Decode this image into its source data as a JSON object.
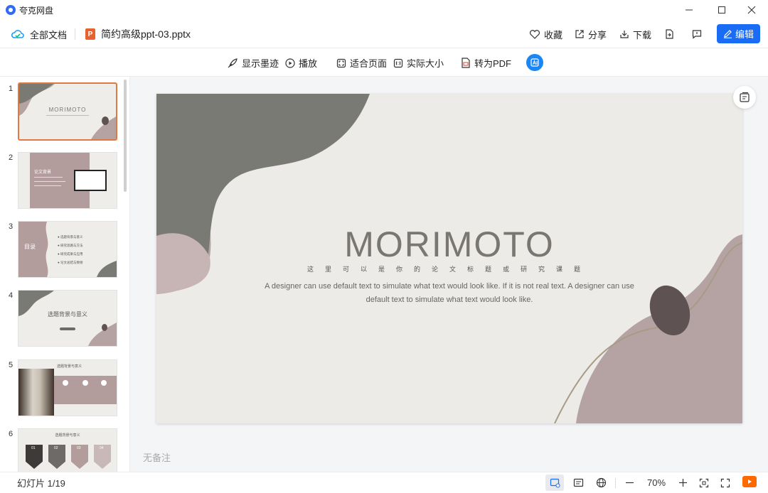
{
  "app": {
    "title": "夸克网盘"
  },
  "window": {
    "minimize": "—",
    "maximize": "☐",
    "close": "✕"
  },
  "header": {
    "all_docs": "全部文档",
    "filename": "简约高级ppt-03.pptx",
    "ppt_badge": "P",
    "favorite": "收藏",
    "share": "分享",
    "download": "下载",
    "edit": "编辑"
  },
  "toolbar": {
    "show_ink": "显示墨迹",
    "play": "播放",
    "fit_page": "适合页面",
    "actual_size": "实际大小",
    "to_pdf": "转为PDF"
  },
  "thumbnails": [
    {
      "num": "1",
      "text": "MORIMOTO"
    },
    {
      "num": "2",
      "text": "论文背景"
    },
    {
      "num": "3",
      "text": "目录",
      "items": [
        "选题背景与意义",
        "研究思路与方法",
        "研究成果与应用",
        "论文总结与致谢"
      ]
    },
    {
      "num": "4",
      "text": "选题背景与意义"
    },
    {
      "num": "5",
      "text": "选题背景与意义"
    },
    {
      "num": "6",
      "text": "选题背景与意义",
      "tags": [
        "01",
        "02",
        "03",
        "04"
      ]
    }
  ],
  "slide": {
    "title": "MORIMOTO",
    "subtitle": "这里可以是你的论文标题或研究课题",
    "body": "A designer can use default text to simulate what text would look like. If it is not real text. A designer can use default text to simulate what text would look like."
  },
  "notes": {
    "placeholder": "无备注"
  },
  "status": {
    "slide_counter": "幻灯片 1/19",
    "zoom": "70%",
    "zoom_out": "—",
    "zoom_in": "+"
  },
  "colors": {
    "accent": "#1a6cf5",
    "active_thumb": "#e07a3c",
    "blob_gray": "#7a7a75",
    "blob_rose": "#b5a3a3",
    "blob_dark": "#5e5352"
  }
}
